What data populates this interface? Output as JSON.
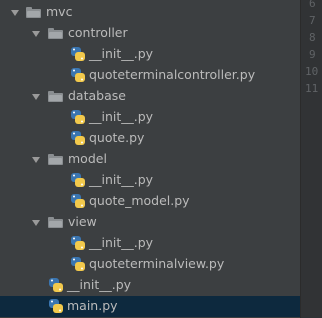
{
  "project_tree": {
    "root": {
      "label": "mvc",
      "icon": "folder-icon"
    },
    "controller": {
      "label": "controller",
      "files": [
        {
          "label": "__init__.py",
          "icon": "python-file-icon"
        },
        {
          "label": "quoteterminalcontroller.py",
          "icon": "python-file-icon"
        }
      ]
    },
    "database": {
      "label": "database",
      "files": [
        {
          "label": "__init__.py",
          "icon": "python-file-icon"
        },
        {
          "label": "quote.py",
          "icon": "python-file-icon"
        }
      ]
    },
    "model": {
      "label": "model",
      "files": [
        {
          "label": "__init__.py",
          "icon": "python-file-icon"
        },
        {
          "label": "quote_model.py",
          "icon": "python-file-icon"
        }
      ]
    },
    "view": {
      "label": "view",
      "files": [
        {
          "label": "__init__.py",
          "icon": "python-file-icon"
        },
        {
          "label": "quoteterminalview.py",
          "icon": "python-file-icon"
        }
      ]
    },
    "root_files": [
      {
        "label": "__init__.py",
        "icon": "python-file-icon"
      },
      {
        "label": "main.py",
        "icon": "python-file-icon",
        "selected": true
      }
    ]
  },
  "gutter": {
    "line_numbers": [
      "6",
      "7",
      "8",
      "9",
      "10",
      "11"
    ]
  },
  "colors": {
    "panel_bg": "#3c3f41",
    "gutter_bg": "#313335",
    "text": "#bbbbbb",
    "selected_bg": "#0d293e",
    "python_blue": "#3a75b0",
    "python_yellow": "#f2c94c"
  }
}
